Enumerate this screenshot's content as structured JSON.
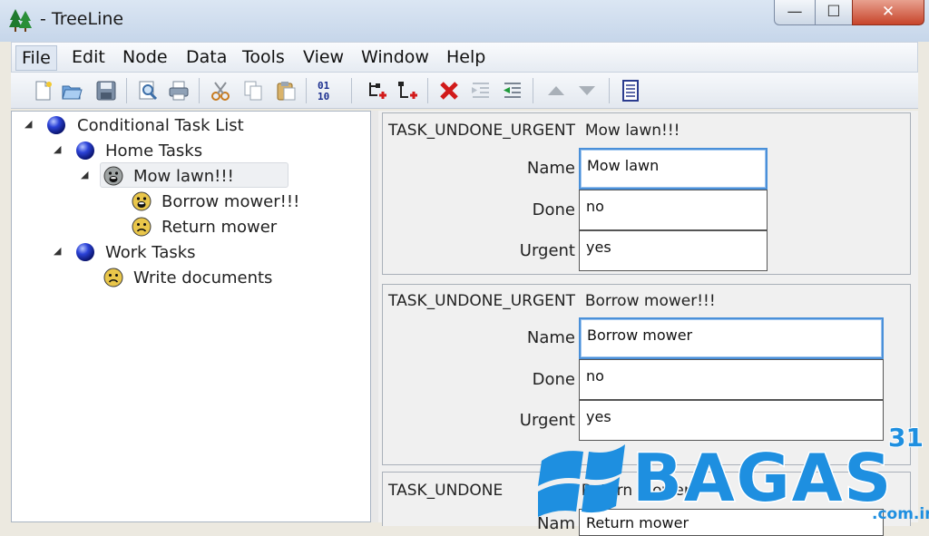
{
  "window": {
    "title": "- TreeLine",
    "minimize_glyph": "—",
    "maximize_glyph": "☐",
    "close_glyph": "✕"
  },
  "menu": [
    "File",
    "Edit",
    "Node",
    "Data",
    "Tools",
    "View",
    "Window",
    "Help"
  ],
  "toolbar": {
    "icons": [
      "new-file-icon",
      "open-file-icon",
      "save-icon",
      "print-preview-icon",
      "print-icon",
      "cut-icon",
      "copy-icon",
      "paste-icon",
      "binary-format-icon",
      "add-child-icon",
      "insert-sibling-icon",
      "delete-node-icon",
      "indent-icon",
      "unindent-icon",
      "move-up-icon",
      "move-down-icon",
      "data-editor-icon"
    ],
    "binary_label_top": "01",
    "binary_label_bottom": "10"
  },
  "tree": {
    "root": "Conditional Task List",
    "home": "Home Tasks",
    "mow": "Mow lawn!!!",
    "borrow": "Borrow mower!!!",
    "return": "Return mower",
    "work": "Work Tasks",
    "write": "Write documents"
  },
  "editor": {
    "labels": {
      "name": "Name",
      "done": "Done",
      "urgent": "Urgent",
      "name_partial": "Nam"
    },
    "node1": {
      "type": "TASK_UNDONE_URGENT",
      "heading": "Mow lawn!!!",
      "name": "Mow lawn",
      "done": "no",
      "urgent": "yes"
    },
    "node2": {
      "type": "TASK_UNDONE_URGENT",
      "heading": "Borrow mower!!!",
      "name": "Borrow mower",
      "done": "no",
      "urgent": "yes"
    },
    "node3": {
      "type": "TASK_UNDONE",
      "heading": "Return mower",
      "name": "Return mower"
    }
  },
  "watermark": {
    "text": "BAGAS",
    "superscript": "31",
    "domain": ".com.in"
  },
  "colors": {
    "accent_focus": "#4a90d9",
    "watermark_blue": "#1e8fe0",
    "node_blue": "#1f2fbf",
    "smiley_yellow": "#e9c64a"
  }
}
